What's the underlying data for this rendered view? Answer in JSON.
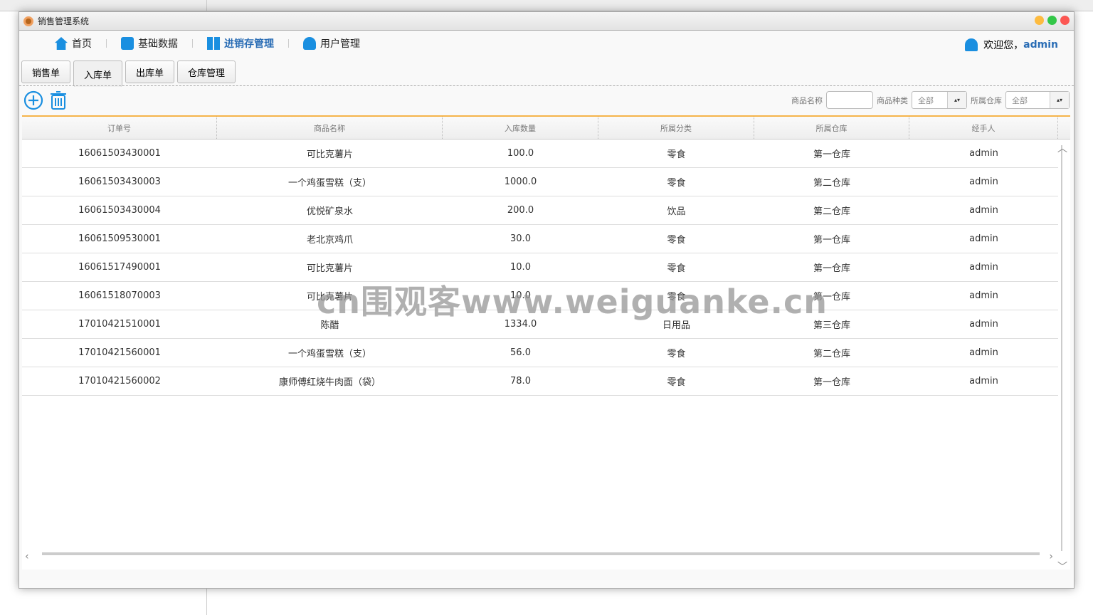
{
  "window": {
    "title": "销售管理系统"
  },
  "nav": [
    {
      "label": "首页",
      "icon": "home-icon"
    },
    {
      "label": "基础数据",
      "icon": "store-icon"
    },
    {
      "label": "进销存管理",
      "icon": "grid-icon",
      "active": true
    },
    {
      "label": "用户管理",
      "icon": "user-gear-icon"
    }
  ],
  "welcome": {
    "text": "欢迎您，",
    "user": "admin"
  },
  "tabs": [
    "销售单",
    "入库单",
    "出库单",
    "仓库管理"
  ],
  "filters": {
    "name_label": "商品名称",
    "name_value": "",
    "category_label": "商品种类",
    "category_value": "全部",
    "warehouse_label": "所属仓库",
    "warehouse_value": "全部"
  },
  "table": {
    "columns": [
      "订单号",
      "商品名称",
      "入库数量",
      "所属分类",
      "所属仓库",
      "经手人"
    ],
    "rows": [
      [
        "16061503430001",
        "可比克薯片",
        "100.0",
        "零食",
        "第一仓库",
        "admin"
      ],
      [
        "16061503430003",
        "一个鸡蛋雪糕（支）",
        "1000.0",
        "零食",
        "第二仓库",
        "admin"
      ],
      [
        "16061503430004",
        "优悦矿泉水",
        "200.0",
        "饮品",
        "第二仓库",
        "admin"
      ],
      [
        "16061509530001",
        "老北京鸡爪",
        "30.0",
        "零食",
        "第一仓库",
        "admin"
      ],
      [
        "16061517490001",
        "可比克薯片",
        "10.0",
        "零食",
        "第一仓库",
        "admin"
      ],
      [
        "16061518070003",
        "可比克薯片",
        "10.0",
        "零食",
        "第一仓库",
        "admin"
      ],
      [
        "17010421510001",
        "陈醋",
        "1334.0",
        "日用品",
        "第三仓库",
        "admin"
      ],
      [
        "17010421560001",
        "一个鸡蛋雪糕（支）",
        "56.0",
        "零食",
        "第二仓库",
        "admin"
      ],
      [
        "17010421560002",
        "康师傅红烧牛肉面（袋）",
        "78.0",
        "零食",
        "第一仓库",
        "admin"
      ]
    ]
  },
  "watermark": "cn围观客www.weiguanke.cn"
}
